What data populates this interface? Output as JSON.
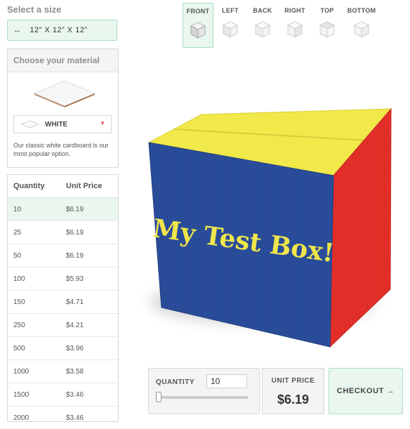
{
  "size": {
    "heading": "Select a size",
    "icon": "resize-arrows-icon",
    "value": "12” X 12” X 12”"
  },
  "material": {
    "heading": "Choose your material",
    "selected": "WHITE",
    "description": "Our classic white cardboard is our most popular option."
  },
  "pricing": {
    "headers": {
      "quantity": "Quantity",
      "unit_price": "Unit Price"
    },
    "rows": [
      {
        "qty": "10",
        "price": "$6.19"
      },
      {
        "qty": "25",
        "price": "$6.19"
      },
      {
        "qty": "50",
        "price": "$6.19"
      },
      {
        "qty": "100",
        "price": "$5.93"
      },
      {
        "qty": "150",
        "price": "$4.71"
      },
      {
        "qty": "250",
        "price": "$4.21"
      },
      {
        "qty": "500",
        "price": "$3.96"
      },
      {
        "qty": "1000",
        "price": "$3.58"
      },
      {
        "qty": "1500",
        "price": "$3.46"
      },
      {
        "qty": "2000",
        "price": "$3.46"
      }
    ]
  },
  "views": [
    {
      "label": "FRONT",
      "active": true
    },
    {
      "label": "LEFT"
    },
    {
      "label": "BACK"
    },
    {
      "label": "RIGHT"
    },
    {
      "label": "TOP"
    },
    {
      "label": "BOTTOM"
    }
  ],
  "box": {
    "front_text": "My Test Box!",
    "colors": {
      "front": "#2b4f9e",
      "side": "#e8312a",
      "top": "#f1e94a",
      "text": "#f0e64a"
    }
  },
  "quantity": {
    "label": "QUANTITY",
    "value": "10"
  },
  "unit_price": {
    "label": "UNIT PRICE",
    "value": "$6.19"
  },
  "checkout": {
    "label": "CHECKOUT →"
  },
  "colors": {
    "accent_bg": "#e9f7ef",
    "accent_border": "#a8ddc0"
  }
}
